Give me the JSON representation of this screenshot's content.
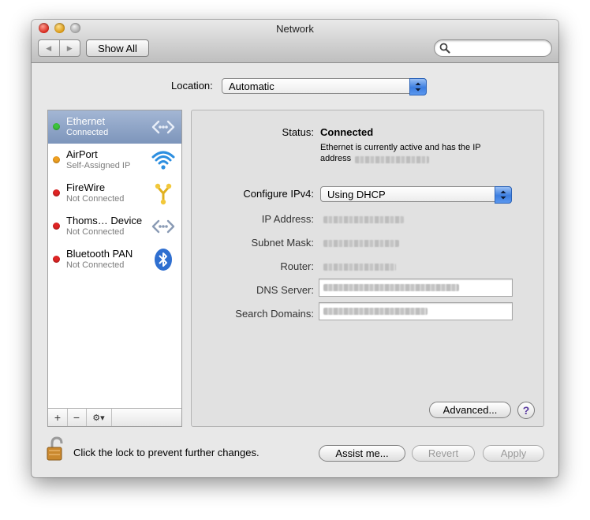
{
  "window": {
    "title": "Network"
  },
  "toolbar": {
    "show_all_label": "Show All",
    "search_placeholder": ""
  },
  "location": {
    "label": "Location:",
    "value": "Automatic"
  },
  "services": [
    {
      "name": "Ethernet",
      "status": "Connected",
      "status_color": "#3cc43c",
      "icon": "ethernet-icon",
      "selected": true
    },
    {
      "name": "AirPort",
      "status": "Self-Assigned IP",
      "status_color": "#f0a020",
      "icon": "wifi-icon",
      "selected": false
    },
    {
      "name": "FireWire",
      "status": "Not Connected",
      "status_color": "#e02424",
      "icon": "firewire-icon",
      "selected": false
    },
    {
      "name": "Thoms… Device",
      "status": "Not Connected",
      "status_color": "#e02424",
      "icon": "ethernet-icon",
      "selected": false
    },
    {
      "name": "Bluetooth PAN",
      "status": "Not Connected",
      "status_color": "#e02424",
      "icon": "bluetooth-icon",
      "selected": false
    }
  ],
  "sidebar_controls": {
    "add": "+",
    "remove": "−",
    "gear": "⚙▾"
  },
  "detail": {
    "status_label": "Status:",
    "status_value": "Connected",
    "status_description": "Ethernet is currently active and has the IP",
    "status_description_2": "address",
    "configure_label": "Configure IPv4:",
    "configure_value": "Using DHCP",
    "ip_label": "IP Address:",
    "subnet_label": "Subnet Mask:",
    "router_label": "Router:",
    "dns_label": "DNS Server:",
    "search_domains_label": "Search Domains:",
    "advanced_label": "Advanced...",
    "help_label": "?"
  },
  "footer": {
    "lock_text": "Click the lock to prevent further changes.",
    "assist_label": "Assist me...",
    "revert_label": "Revert",
    "apply_label": "Apply"
  }
}
